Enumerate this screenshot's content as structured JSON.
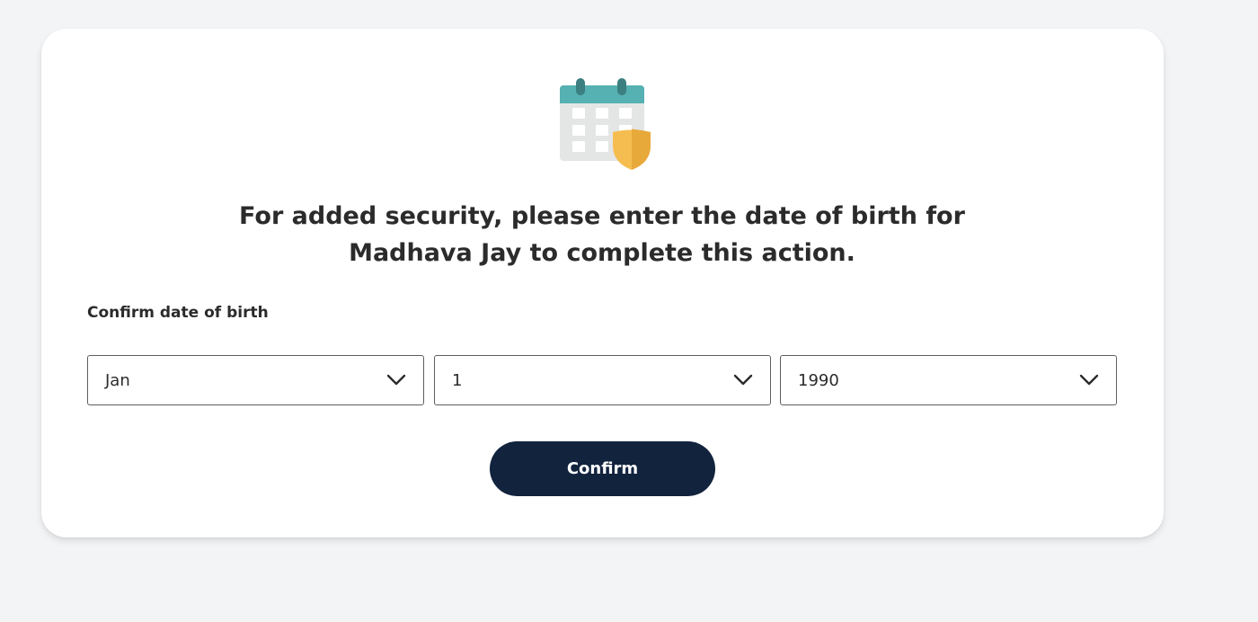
{
  "dialog": {
    "headline_line1": "For added security, please enter the date of birth for",
    "headline_line2": "Madhava Jay to complete this action.",
    "dob_label": "Confirm date of birth",
    "month": {
      "selected": "Jan"
    },
    "day": {
      "selected": "1"
    },
    "year": {
      "selected": "1990"
    },
    "confirm_label": "Confirm"
  },
  "icons": {
    "illustration": "calendar-shield-icon",
    "dropdown": "chevron-down-icon"
  },
  "colors": {
    "button_bg": "#12233e",
    "calendar_header": "#55b1b2",
    "shield": "#f0b84b",
    "page_bg": "#f3f4f6"
  }
}
